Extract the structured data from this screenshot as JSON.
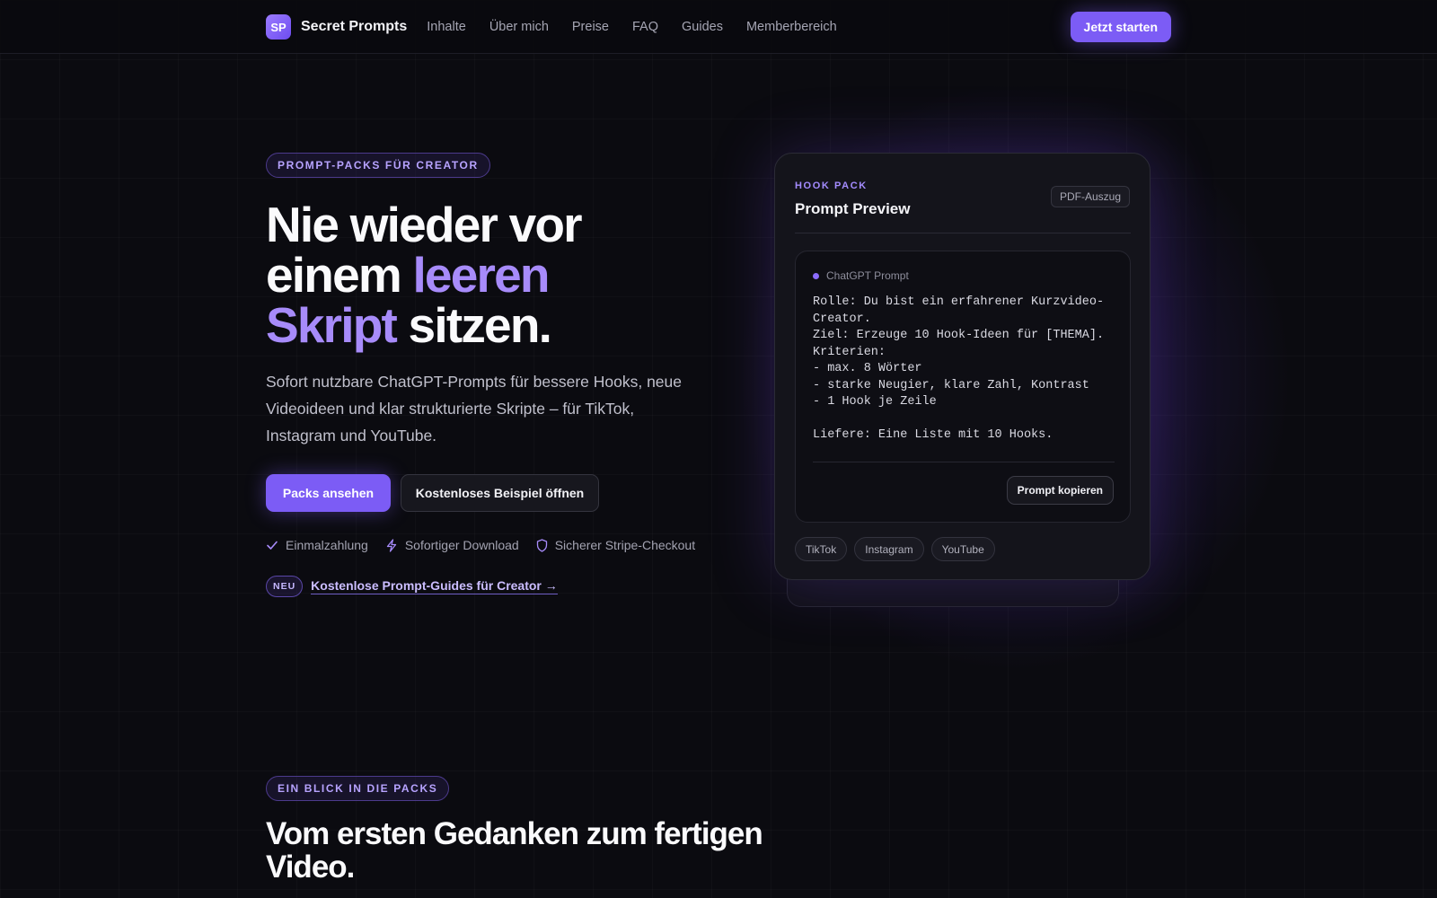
{
  "nav": {
    "logo_mark": "SP",
    "brand": "Secret Prompts",
    "links": [
      "Inhalte",
      "Über mich",
      "Preise",
      "FAQ",
      "Guides",
      "Memberbereich"
    ],
    "cta": "Jetzt starten"
  },
  "hero": {
    "eyebrow": "PROMPT-PACKS FÜR CREATOR",
    "headline": {
      "line1": "Nie wieder vor",
      "line2_plain": "einem ",
      "line2_accent": "leeren",
      "line3_accent": "Skript",
      "line3_plain": " sitzen."
    },
    "subtitle": "Sofort nutzbare ChatGPT-Prompts für bessere Hooks, neue Videoideen und klar strukturierte Skripte – für TikTok, Instagram und YouTube.",
    "primary_button": "Packs ansehen",
    "secondary_button": "Kostenloses Beispiel öffnen",
    "features": [
      {
        "icon": "check-icon",
        "label": "Einmalzahlung"
      },
      {
        "icon": "lightning-icon",
        "label": "Sofortiger Download"
      },
      {
        "icon": "shield-icon",
        "label": "Sicherer Stripe-Checkout"
      }
    ],
    "new_badge": "NEU",
    "new_link": "Kostenlose Prompt-Guides für Creator →"
  },
  "preview_card": {
    "kicker": "HOOK PACK",
    "title": "Prompt Preview",
    "badge": "PDF-Auszug",
    "prompt_label": "ChatGPT Prompt",
    "prompt_text": "Rolle: Du bist ein erfahrener Kurzvideo-\nCreator.\nZiel: Erzeuge 10 Hook-Ideen für [THEMA].\nKriterien:\n- max. 8 Wörter\n- starke Neugier, klare Zahl, Kontrast\n- 1 Hook je Zeile\n\nLiefere: Eine Liste mit 10 Hooks.",
    "copy_button": "Prompt kopieren",
    "tags": [
      "TikTok",
      "Instagram",
      "YouTube"
    ]
  },
  "section2": {
    "eyebrow": "EIN BLICK IN DIE PACKS",
    "title": "Vom ersten Gedanken zum fertigen Video."
  },
  "colors": {
    "accent": "#7c5cf5",
    "accent_light": "#a78bfa",
    "background": "#0b0b10"
  }
}
